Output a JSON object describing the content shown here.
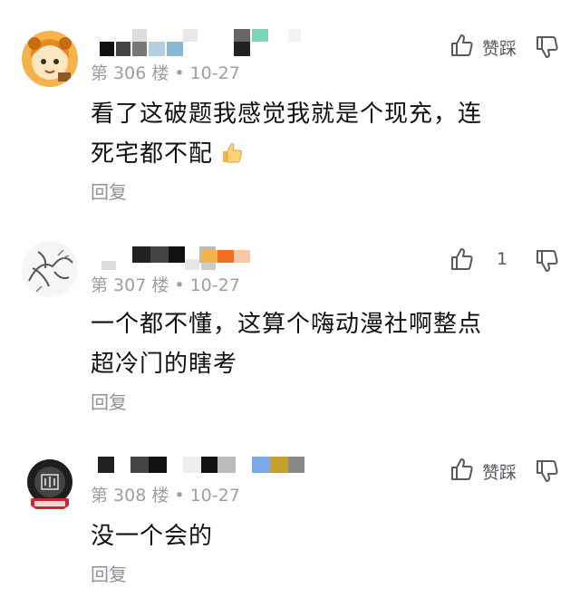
{
  "comments": [
    {
      "floor": "第 306 楼",
      "date": "10-27",
      "text_line1": "看了这破题我感觉我就是个现充，连",
      "text_line2": "死宅都不配",
      "reply_label": "回复",
      "like_text": "",
      "dislike_text": "赞踩"
    },
    {
      "floor": "第 307 楼",
      "date": "10-27",
      "text_line1": "一个都不懂，这算个嗨动漫社啊整点",
      "text_line2": "超冷门的瞎考",
      "reply_label": "回复",
      "like_text": "1",
      "dislike_text": ""
    },
    {
      "floor": "第 308 楼",
      "date": "10-27",
      "text_line1": "没一个会的",
      "text_line2": "",
      "reply_label": "回复",
      "like_text": "",
      "dislike_text": "赞踩"
    }
  ],
  "separator": "•",
  "icons": {
    "like": "thumb-up-outline-icon",
    "dislike": "thumb-down-outline-icon",
    "emoji": "thumbs-up-emoji-icon"
  },
  "colors": {
    "meta_text": "#9aa0a6",
    "body_text": "#111111",
    "reply_text": "#8e9399",
    "icon": "#555a60"
  }
}
